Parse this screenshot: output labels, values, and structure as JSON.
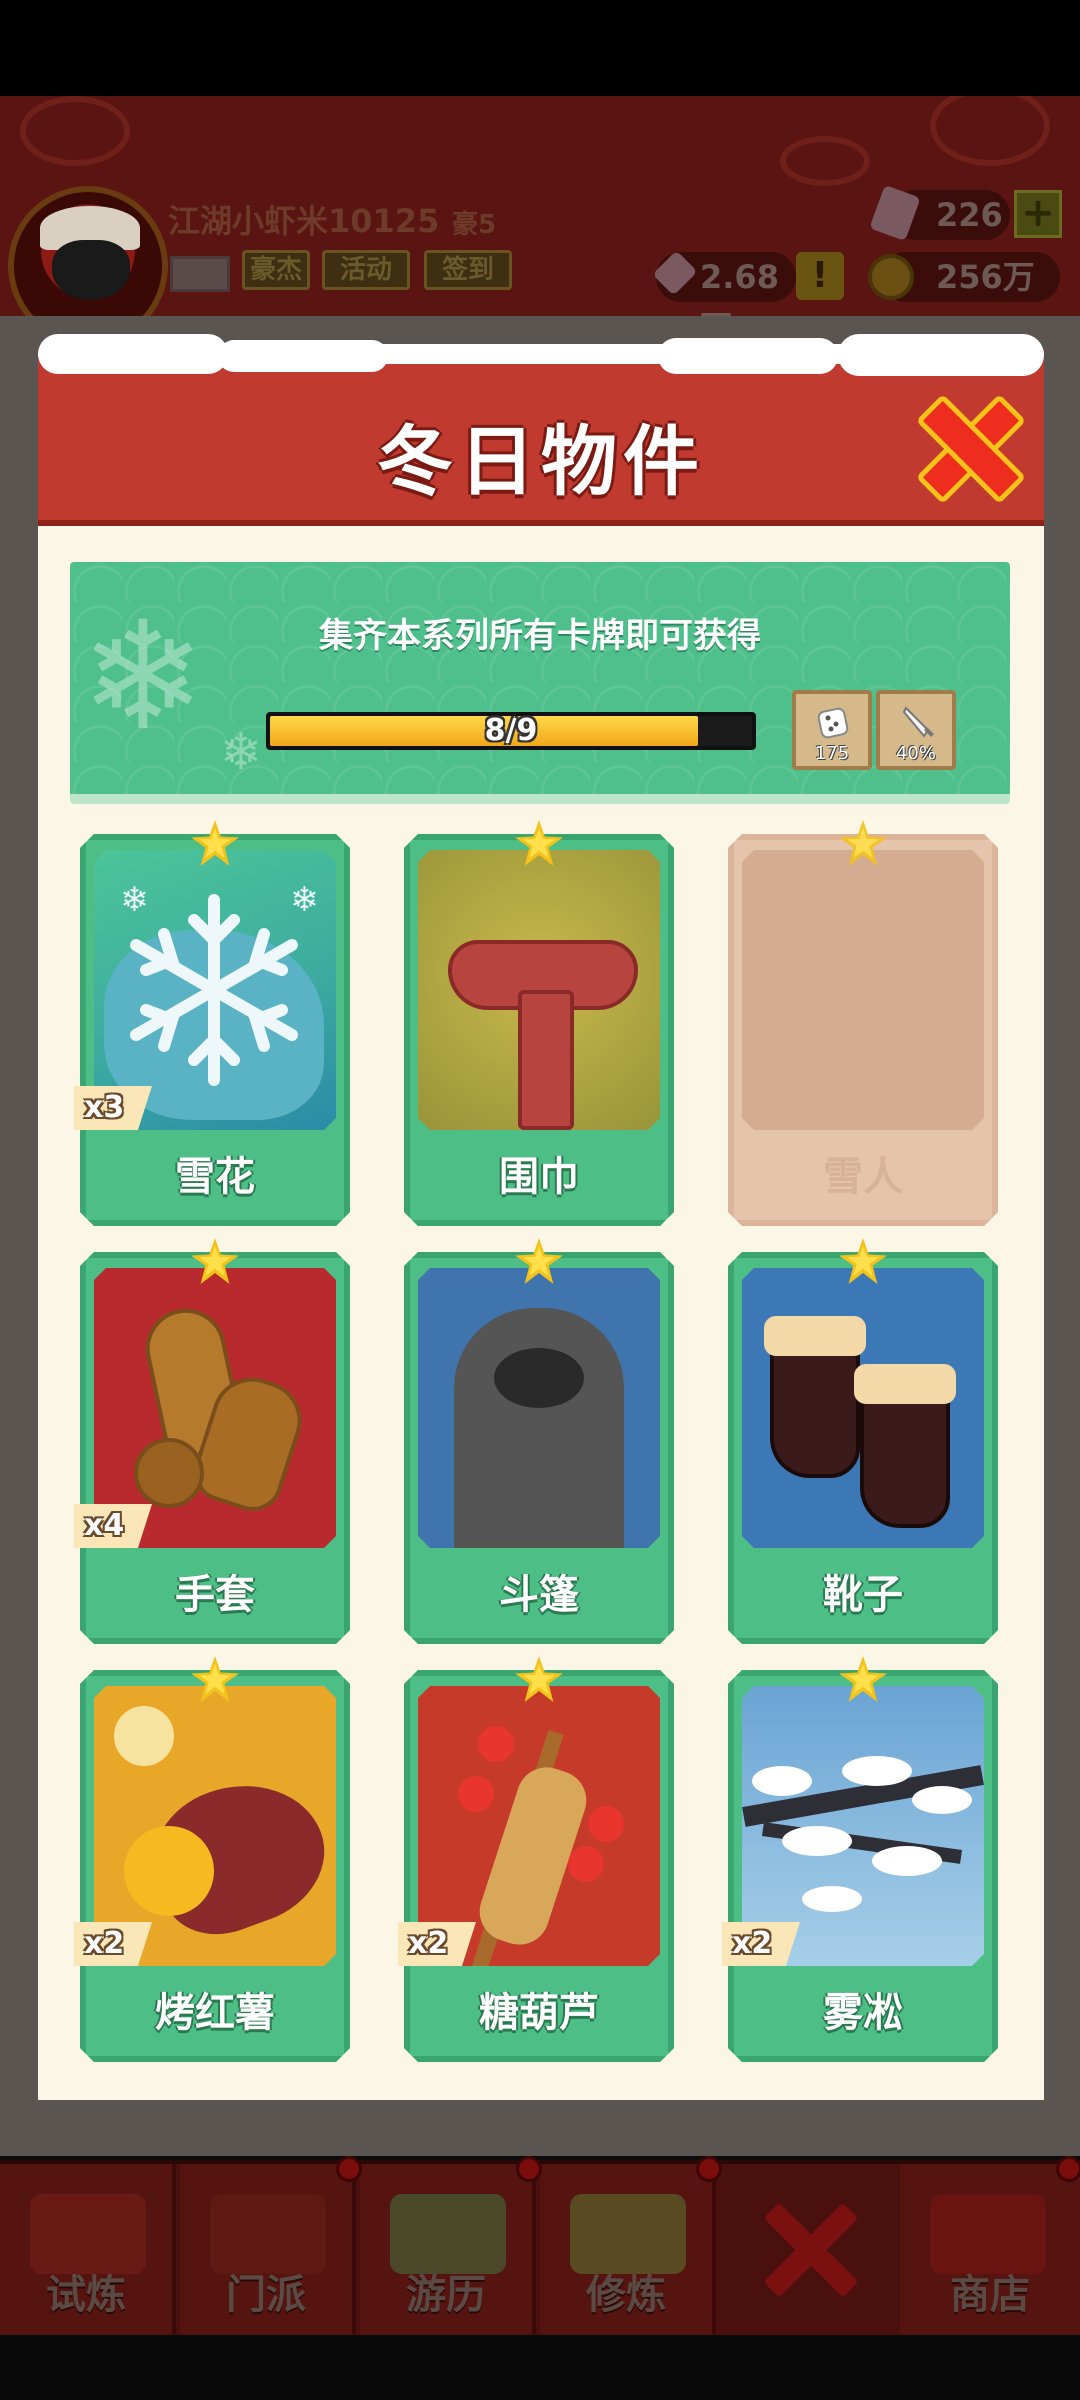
{
  "header": {
    "player_name": "江湖小虾米10125",
    "rank": "豪5",
    "chips": [
      "豪杰",
      "活动",
      "签到"
    ],
    "gems": "226",
    "silver": "2.68万",
    "gold": "256万",
    "plus_label": "+",
    "alert_label": "!"
  },
  "modal": {
    "title": "冬日物件",
    "reward_text": "集齐本系列所有卡牌即可获得",
    "progress": {
      "label": "8/9",
      "value": 8,
      "max": 9
    },
    "rewards": [
      {
        "icon": "dice-icon",
        "value": "175"
      },
      {
        "icon": "sword-icon",
        "value": "40%"
      }
    ],
    "cards": [
      {
        "name": "雪花",
        "count": "x3",
        "owned": true,
        "icon": "snowflake"
      },
      {
        "name": "围巾",
        "count": "",
        "owned": true,
        "icon": "scarf"
      },
      {
        "name": "雪人",
        "count": "",
        "owned": false,
        "icon": "snowman"
      },
      {
        "name": "手套",
        "count": "x4",
        "owned": true,
        "icon": "gloves"
      },
      {
        "name": "斗篷",
        "count": "",
        "owned": true,
        "icon": "cloak"
      },
      {
        "name": "靴子",
        "count": "",
        "owned": true,
        "icon": "boots"
      },
      {
        "name": "烤红薯",
        "count": "x2",
        "owned": true,
        "icon": "sweet-potato"
      },
      {
        "name": "糖葫芦",
        "count": "x2",
        "owned": true,
        "icon": "candied-haws"
      },
      {
        "name": "雾凇",
        "count": "x2",
        "owned": true,
        "icon": "rime"
      }
    ]
  },
  "bottom_nav": [
    "试炼",
    "门派",
    "游历",
    "修炼",
    "商店"
  ],
  "colors": {
    "modal_header": "#c03a2f",
    "card_green": "#4cbe86",
    "star_yellow": "#f3c21b",
    "close_red": "#ee2d1f"
  }
}
